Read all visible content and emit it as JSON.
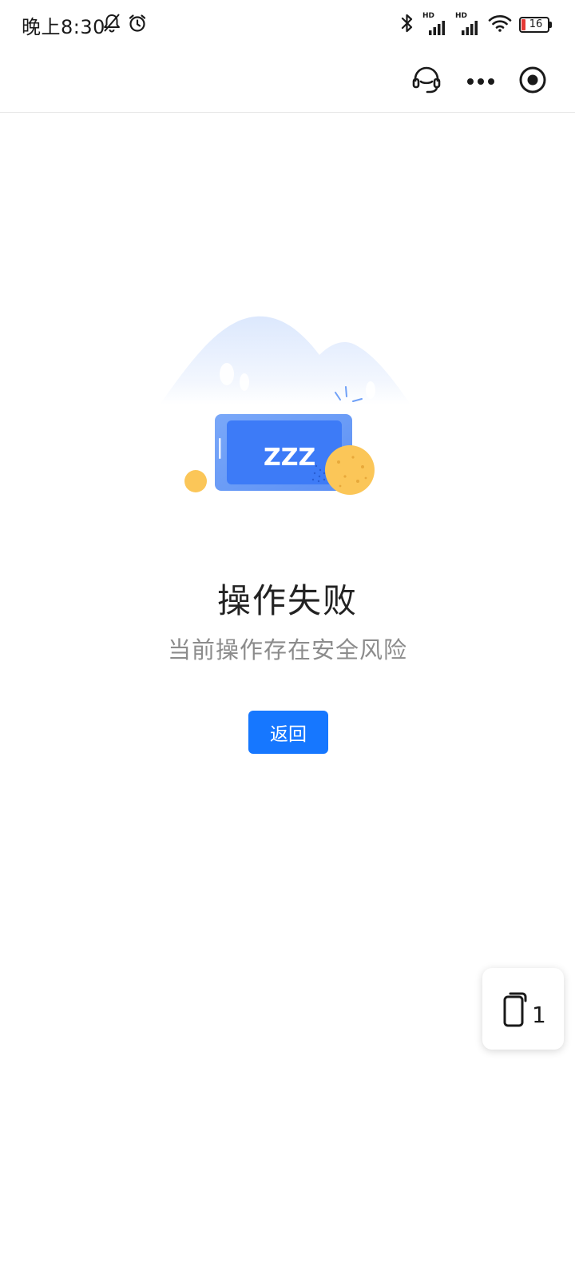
{
  "status_bar": {
    "time": "晚上8:30",
    "hd_label_1": "HD",
    "hd_label_2": "HD",
    "battery_level": "16"
  },
  "nav": {
    "icons": [
      "headset-icon",
      "more-icon",
      "close-miniprogram-icon"
    ]
  },
  "main": {
    "title": "操作失败",
    "message": "当前操作存在安全风险",
    "back_button_label": "返回",
    "illustration_text": "ZZZ"
  },
  "floating": {
    "page_count": "1"
  },
  "colors": {
    "accent": "#1677ff",
    "title": "#222222",
    "message": "#8c8c8c",
    "illustration_blue": "#3d7bf7",
    "illustration_yellow": "#fbc658",
    "battery_low": "#e53935"
  }
}
